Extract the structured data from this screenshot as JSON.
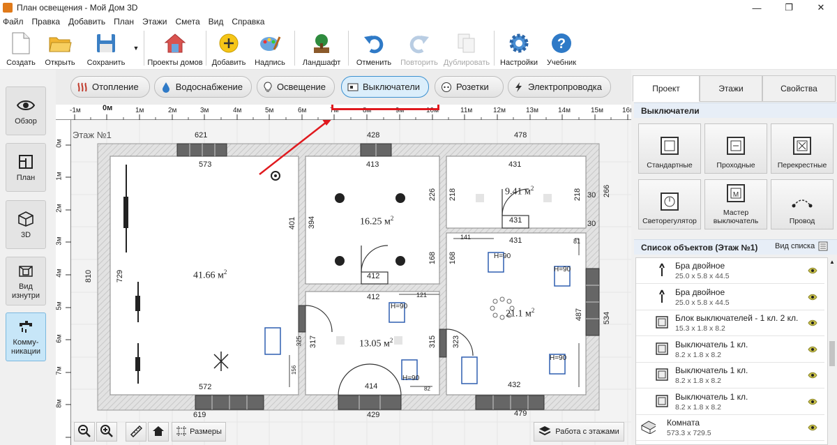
{
  "window": {
    "title": "План освещения - Мой Дом 3D",
    "minimize": "—",
    "maximize": "❐",
    "close": "✕"
  },
  "menu": [
    "Файл",
    "Правка",
    "Добавить",
    "План",
    "Этажи",
    "Смета",
    "Вид",
    "Справка"
  ],
  "toolbar": {
    "create": "Создать",
    "open": "Открыть",
    "save": "Сохранить",
    "projects": "Проекты домов",
    "add": "Добавить",
    "label": "Надпись",
    "landscape": "Ландшафт",
    "undo": "Отменить",
    "redo": "Повторить",
    "duplicate": "Дублировать",
    "settings": "Настройки",
    "tutorial": "Учебник"
  },
  "left_nav": {
    "overview": "Обзор",
    "plan": "План",
    "view3d": "3D",
    "inside1": "Вид",
    "inside2": "изнутри",
    "comm1": "Комму-",
    "comm2": "никации"
  },
  "categories": [
    "Отопление",
    "Водоснабжение",
    "Освещение",
    "Выключатели",
    "Розетки",
    "Электропроводка"
  ],
  "ruler": {
    "h": [
      "-1м",
      "0м",
      "1м",
      "2м",
      "3м",
      "4м",
      "5м",
      "6м",
      "7м",
      "8м",
      "9м",
      "10м",
      "11м",
      "12м",
      "13м",
      "14м",
      "15м",
      "16м"
    ],
    "v": [
      "0м",
      "1м",
      "2м",
      "3м",
      "4м",
      "5м",
      "6м",
      "7м",
      "8м"
    ]
  },
  "plan": {
    "floor_label": "Этаж №1",
    "dims": {
      "top_621": "621",
      "top_428": "428",
      "top_478": "478",
      "r1_573": "573",
      "r2_413": "413",
      "r3_431": "431",
      "left_810": "810",
      "left_729": "729",
      "d_401": "401",
      "d_394": "394",
      "d_226": "226",
      "d_218a": "218",
      "d_218b": "218",
      "d_30a": "30",
      "d_30b": "30",
      "d_266": "266",
      "d_431b": "431",
      "d_431c": "431",
      "d_141": "141",
      "d_81": "81",
      "d_168a": "168",
      "d_168b": "168",
      "d_412a": "412",
      "d_412b": "412",
      "d_121": "121",
      "d_317": "317",
      "d_315": "315",
      "d_325": "325",
      "d_323": "323",
      "d_487": "487",
      "d_534": "534",
      "d_156": "156",
      "d_82": "82",
      "d_414": "414",
      "d_432": "432",
      "b_572": "572",
      "b_619": "619",
      "b_429": "429",
      "b_479": "479"
    },
    "areas": {
      "living": "41.66 м",
      "kitchen": "16.25 м",
      "bath": "9.41 м",
      "hall": "13.05 м",
      "bedroom": "21.1 м",
      "sup": "2"
    },
    "h90": "H=90"
  },
  "canvas_buttons": {
    "sizes": "Размеры",
    "floors": "Работа с этажами"
  },
  "right_panel": {
    "tabs": [
      "Проект",
      "Этажи",
      "Свойства"
    ],
    "switches_title": "Выключатели",
    "tiles": [
      "Стандартные",
      "Проходные",
      "Перекрестные",
      "Светорегулятор",
      "Мастер выключатель",
      "Провод"
    ],
    "objects_title": "Список объектов (Этаж №1)",
    "view_list": "Вид списка",
    "objects": [
      {
        "name": "Бра двойное",
        "dims": "25.0 x 5.8 x 44.5",
        "icon": "sconce-icon"
      },
      {
        "name": "Бра двойное",
        "dims": "25.0 x 5.8 x 44.5",
        "icon": "sconce-icon"
      },
      {
        "name": "Блок выключателей - 1 кл. 2 кл.",
        "dims": "15.3 x 1.8 x 8.2",
        "icon": "switch-icon"
      },
      {
        "name": "Выключатель 1 кл.",
        "dims": "8.2 x 1.8 x 8.2",
        "icon": "switch-icon"
      },
      {
        "name": "Выключатель 1 кл.",
        "dims": "8.2 x 1.8 x 8.2",
        "icon": "switch-icon"
      },
      {
        "name": "Выключатель 1 кл.",
        "dims": "8.2 x 1.8 x 8.2",
        "icon": "switch-icon"
      },
      {
        "name": "Комната",
        "dims": "573.3 x 729.5",
        "icon": "room-icon"
      }
    ]
  },
  "colors": {
    "accent": "#3b90d0",
    "highlight": "#e0191e",
    "wall": "#d8d8d8",
    "room": "#ffffff"
  }
}
